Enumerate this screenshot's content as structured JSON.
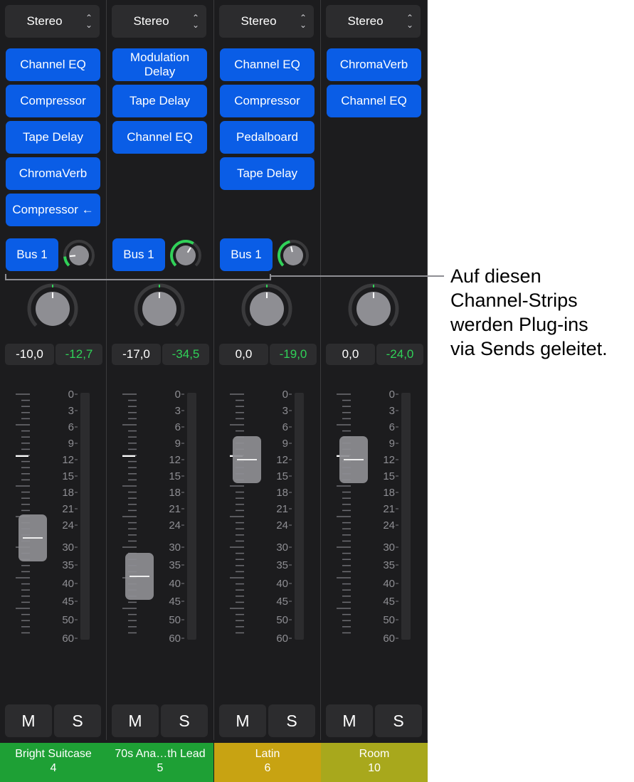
{
  "strips": [
    {
      "io": "Stereo",
      "plugins": [
        "Channel EQ",
        "Compressor",
        "Tape Delay",
        "ChromaVerb",
        "Compressor ←"
      ],
      "send": {
        "label": "Bus 1",
        "level": 0.15
      },
      "pan": 0.0,
      "volume": "-10,0",
      "peak": "-12,7",
      "fader_db": -27.5,
      "mute": "M",
      "solo": "S",
      "name": "Bright Suitcase",
      "number": "4",
      "name_color": "#1ea035"
    },
    {
      "io": "Stereo",
      "plugins": [
        "Modulation Delay",
        "Tape Delay",
        "Channel EQ"
      ],
      "send": {
        "label": "Bus 1",
        "level": 0.62
      },
      "pan": 0.0,
      "volume": "-17,0",
      "peak": "-34,5",
      "fader_db": -38.0,
      "mute": "M",
      "solo": "S",
      "name": "70s Ana…th Lead",
      "number": "5",
      "name_color": "#1ea035"
    },
    {
      "io": "Stereo",
      "plugins": [
        "Channel EQ",
        "Compressor",
        "Pedalboard",
        "Tape Delay"
      ],
      "send": {
        "label": "Bus 1",
        "level": 0.45
      },
      "pan": 0.0,
      "volume": "0,0",
      "peak": "-19,0",
      "fader_db": -12.0,
      "mute": "M",
      "solo": "S",
      "name": "Latin",
      "number": "6",
      "name_color": "#c8a312"
    },
    {
      "io": "Stereo",
      "plugins": [
        "ChromaVerb",
        "Channel EQ"
      ],
      "send": null,
      "pan": 0.0,
      "volume": "0,0",
      "peak": "-24,0",
      "fader_db": -12.0,
      "mute": "M",
      "solo": "S",
      "name": "Room",
      "number": "10",
      "name_color": "#a8a81c"
    }
  ],
  "scale_labels": [
    "0",
    "3",
    "6",
    "9",
    "12",
    "15",
    "18",
    "21",
    "24",
    "30",
    "35",
    "40",
    "45",
    "50",
    "60"
  ],
  "callout": {
    "lines": [
      "Auf diesen",
      "Channel-Strips",
      "werden Plug-ins",
      "via Sends geleitet."
    ]
  },
  "colors": {
    "plugin_blue": "#0a5de6",
    "meter_green": "#30d158",
    "background": "#1c1c1e"
  }
}
